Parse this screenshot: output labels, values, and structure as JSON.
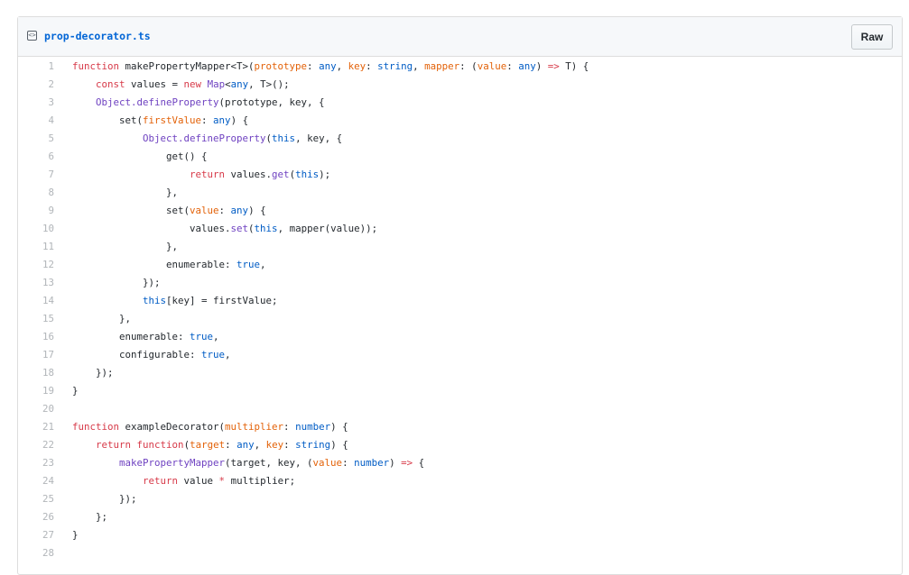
{
  "file": {
    "name": "prop-decorator.ts",
    "raw_label": "Raw",
    "icon": "code-file-icon",
    "icon_glyph": "<>"
  },
  "lines": [
    {
      "n": "1",
      "html": "function makePropertyMapper<T>(prototype: any, key: string, mapper: (value: any) => T) {"
    },
    {
      "n": "2",
      "html": "    const values = new Map<any, T>();"
    },
    {
      "n": "3",
      "html": "    Object.defineProperty(prototype, key, {"
    },
    {
      "n": "4",
      "html": "        set(firstValue: any) {"
    },
    {
      "n": "5",
      "html": "            Object.defineProperty(this, key, {"
    },
    {
      "n": "6",
      "html": "                get() {"
    },
    {
      "n": "7",
      "html": "                    return values.get(this);"
    },
    {
      "n": "8",
      "html": "                },"
    },
    {
      "n": "9",
      "html": "                set(value: any) {"
    },
    {
      "n": "10",
      "html": "                    values.set(this, mapper(value));"
    },
    {
      "n": "11",
      "html": "                },"
    },
    {
      "n": "12",
      "html": "                enumerable: true,"
    },
    {
      "n": "13",
      "html": "            });"
    },
    {
      "n": "14",
      "html": "            this[key] = firstValue;"
    },
    {
      "n": "15",
      "html": "        },"
    },
    {
      "n": "16",
      "html": "        enumerable: true,"
    },
    {
      "n": "17",
      "html": "        configurable: true,"
    },
    {
      "n": "18",
      "html": "    });"
    },
    {
      "n": "19",
      "html": "}"
    },
    {
      "n": "20",
      "html": ""
    },
    {
      "n": "21",
      "html": "function exampleDecorator(multiplier: number) {"
    },
    {
      "n": "22",
      "html": "    return function(target: any, key: string) {"
    },
    {
      "n": "23",
      "html": "        makePropertyMapper(target, key, (value: number) => {"
    },
    {
      "n": "24",
      "html": "            return value * multiplier;"
    },
    {
      "n": "25",
      "html": "        });"
    },
    {
      "n": "26",
      "html": "    };"
    },
    {
      "n": "27",
      "html": "}"
    },
    {
      "n": "28",
      "html": ""
    }
  ],
  "colors": {
    "keyword": "#d73a49",
    "param": "#e36209",
    "function": "#6f42c1",
    "constant": "#005cc5",
    "text": "#24292e",
    "line_number": "#b1b5b9",
    "link": "#0366d6"
  }
}
